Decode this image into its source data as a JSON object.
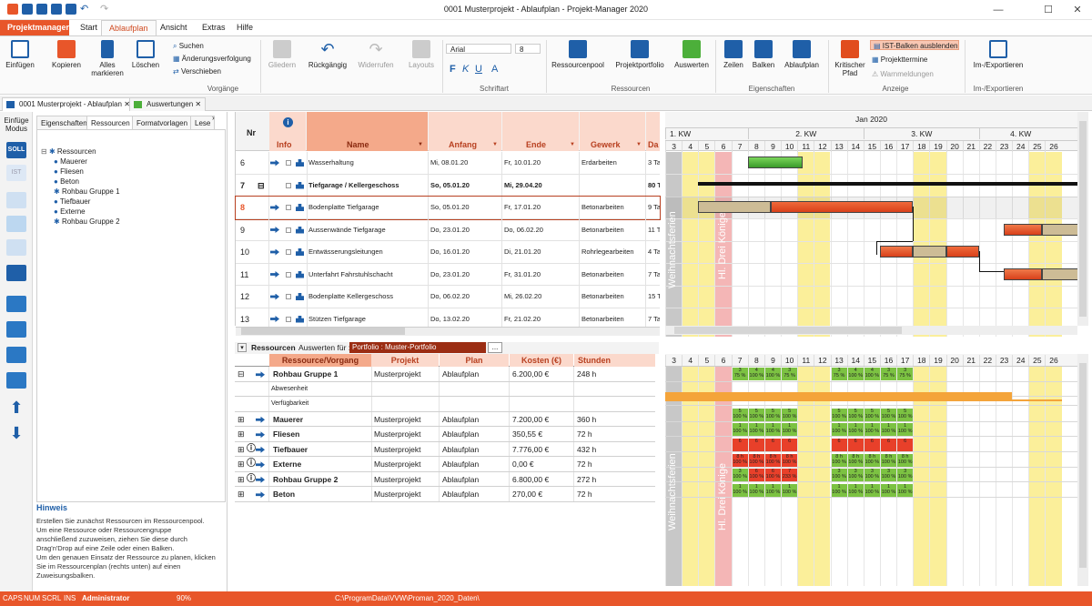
{
  "window": {
    "title": "0001 Musterprojekt - Ablaufplan - Projekt-Manager 2020"
  },
  "ribbon_tabs": [
    "Projektmanager",
    "Start",
    "Ablaufplan",
    "Ansicht",
    "Extras",
    "Hilfe"
  ],
  "ribbon": {
    "einfuegen": "Einfügen",
    "kopieren": "Kopieren",
    "alles_markieren": "Alles markieren",
    "loeschen": "Löschen",
    "suchen": "Suchen",
    "aenderungsverfolgung": "Änderungsverfolgung",
    "verschieben": "Verschieben",
    "gliedern": "Gliedern",
    "rueckgaengig": "Rückgängig",
    "wiederrufen": "Widerrufen",
    "layouts": "Layouts",
    "group_vorgaenge": "Vorgänge",
    "font_name": "Arial",
    "font_size": "8",
    "font_letters": [
      "F",
      "K",
      "U",
      "A"
    ],
    "group_schriftart": "Schriftart",
    "ressourcenpool": "Ressourcenpool",
    "projektportfolio": "Projektportfolio",
    "auswerten": "Auswerten",
    "group_ressourcen": "Ressourcen",
    "zeilen": "Zeilen",
    "balken": "Balken",
    "ablaufplan": "Ablaufplan",
    "group_eigenschaften": "Eigenschaften",
    "kritischer_pfad": "Kritischer Pfad",
    "ist_balken": "IST-Balken ausblenden",
    "projekttermine": "Projekttermine",
    "warnmeldungen": "Warnmeldungen",
    "group_anzeige": "Anzeige",
    "im_export": "Im-/Exportieren",
    "group_im_export": "Im-/Exportieren"
  },
  "doc_tabs": [
    "0001 Musterprojekt - Ablaufplan",
    "Auswertungen"
  ],
  "rail": {
    "label1": "Einfüge",
    "label2": "Modus",
    "soll": "SOLL",
    "ist": "IST"
  },
  "panel": {
    "tabs": [
      "Eigenschaften",
      "Ressourcen",
      "Formatvorlagen",
      "Lese"
    ],
    "tree_root": "Ressourcen",
    "tree_items": [
      "Mauerer",
      "Fliesen",
      "Beton",
      "Rohbau Gruppe 1",
      "Tiefbauer",
      "Externe",
      "Rohbau Gruppe 2"
    ],
    "hint_title": "Hinweis",
    "hint_lines": [
      "Erstellen Sie zunächst Ressourcen im Ressourcenpool.",
      "Um eine Ressource oder Ressourcengruppe",
      "anschließend zuzuweisen, ziehen Sie diese durch",
      "Drag'n'Drop auf eine Zeile oder einen Balken.",
      "Um den genauen Einsatz der Ressource zu planen, klicken",
      "Sie im Ressourcenplan (rechts unten) auf einen",
      "Zuweisungsbalken."
    ]
  },
  "task_table": {
    "headers": {
      "nr": "Nr",
      "info": "Info",
      "name": "Name",
      "anfang": "Anfang",
      "ende": "Ende",
      "gewerk": "Gewerk",
      "dauer": "Da"
    },
    "rows": [
      {
        "nr": "6",
        "name": "Wasserhaltung",
        "anfang": "Mi, 08.01.20",
        "ende": "Fr, 10.01.20",
        "gewerk": "Erdarbeiten",
        "dauer": "3 Ta",
        "bold": false
      },
      {
        "nr": "7",
        "name": "Tiefgarage / Kellergeschoss",
        "anfang": "So, 05.01.20",
        "ende": "Mi, 29.04.20",
        "gewerk": "",
        "dauer": "80 T",
        "bold": true
      },
      {
        "nr": "8",
        "name": "Bodenplatte Tiefgarage",
        "anfang": "So, 05.01.20",
        "ende": "Fr, 17.01.20",
        "gewerk": "Betonarbeiten",
        "dauer": "9 Ta",
        "bold": false
      },
      {
        "nr": "9",
        "name": "Aussenwände Tiefgarage",
        "anfang": "Do, 23.01.20",
        "ende": "Do, 06.02.20",
        "gewerk": "Betonarbeiten",
        "dauer": "11 T",
        "bold": false
      },
      {
        "nr": "10",
        "name": "Entwässerungsleitungen",
        "anfang": "Do, 16.01.20",
        "ende": "Di, 21.01.20",
        "gewerk": "Rohrlegearbeiten",
        "dauer": "4 Ta",
        "bold": false
      },
      {
        "nr": "11",
        "name": "Unterfahrt Fahrstuhlschacht",
        "anfang": "Do, 23.01.20",
        "ende": "Fr, 31.01.20",
        "gewerk": "Betonarbeiten",
        "dauer": "7 Ta",
        "bold": false
      },
      {
        "nr": "12",
        "name": "Bodenplatte Kellergeschoss",
        "anfang": "Do, 06.02.20",
        "ende": "Mi, 26.02.20",
        "gewerk": "Betonarbeiten",
        "dauer": "15 T",
        "bold": false
      },
      {
        "nr": "13",
        "name": "Stützen Tiefgarage",
        "anfang": "Do, 13.02.20",
        "ende": "Fr, 21.02.20",
        "gewerk": "Betonarbeiten",
        "dauer": "7 Ta",
        "bold": false
      }
    ]
  },
  "gantt": {
    "month": "Jan 2020",
    "weeks": [
      "1. KW",
      "2. KW",
      "3. KW",
      "4. KW"
    ],
    "days": [
      "3",
      "4",
      "5",
      "6",
      "7",
      "8",
      "9",
      "10",
      "11",
      "12",
      "13",
      "14",
      "15",
      "16",
      "17",
      "18",
      "19",
      "20",
      "21",
      "22",
      "23",
      "24",
      "25",
      "26"
    ],
    "holiday1": "Weihnachtsferien",
    "holiday2": "Hl. Drei Könige"
  },
  "res_bar": {
    "title": "Ressourcen",
    "auswerten_label": "Auswerten für :",
    "portfolio": "Portfolio : Muster-Portfolio",
    "btn": "..."
  },
  "res_table": {
    "headers": {
      "name": "Ressource/Vorgang",
      "projekt": "Projekt",
      "plan": "Plan",
      "kosten": "Kosten (€)",
      "stunden": "Stunden"
    },
    "rows": [
      {
        "name": "Rohbau Gruppe 1",
        "projekt": "Musterprojekt",
        "plan": "Ablaufplan",
        "kosten": "6.200,00 €",
        "stunden": "248 h",
        "warn": false,
        "expand": "⊟"
      },
      {
        "name": "Abwesenheit",
        "projekt": "",
        "plan": "",
        "kosten": "",
        "stunden": "",
        "warn": false,
        "expand": "",
        "sub": true
      },
      {
        "name": "Verfügbarkeit",
        "projekt": "",
        "plan": "",
        "kosten": "",
        "stunden": "",
        "warn": false,
        "expand": "",
        "sub": true
      },
      {
        "name": "Mauerer",
        "projekt": "Musterprojekt",
        "plan": "Ablaufplan",
        "kosten": "7.200,00 €",
        "stunden": "360 h",
        "warn": false,
        "expand": "⊞"
      },
      {
        "name": "Fliesen",
        "projekt": "Musterprojekt",
        "plan": "Ablaufplan",
        "kosten": "350,55 €",
        "stunden": "72 h",
        "warn": false,
        "expand": "⊞"
      },
      {
        "name": "Tiefbauer",
        "projekt": "Musterprojekt",
        "plan": "Ablaufplan",
        "kosten": "7.776,00 €",
        "stunden": "432 h",
        "warn": true,
        "expand": "⊞"
      },
      {
        "name": "Externe",
        "projekt": "Musterprojekt",
        "plan": "Ablaufplan",
        "kosten": "0,00 €",
        "stunden": "72 h",
        "warn": true,
        "expand": "⊞"
      },
      {
        "name": "Rohbau Gruppe 2",
        "projekt": "Musterprojekt",
        "plan": "Ablaufplan",
        "kosten": "6.800,00 €",
        "stunden": "272 h",
        "warn": true,
        "expand": "⊞"
      },
      {
        "name": "Beton",
        "projekt": "Musterprojekt",
        "plan": "Ablaufplan",
        "kosten": "270,00 €",
        "stunden": "72 h",
        "warn": false,
        "expand": "⊞"
      }
    ]
  },
  "status": {
    "caps": "CAPS",
    "num": "NUM",
    "scrl": "SCRL",
    "ins": "INS",
    "user": "Administrator",
    "zoom": "90%",
    "path": "C:\\ProgramData\\VVW\\Proman_2020_Daten\\"
  },
  "colors": {
    "accent": "#e8562a",
    "header_bg": "#fbd9cc",
    "weekend": "#fbef9a",
    "holiday": "#f4b6b6",
    "bar_green": "#4caf3a",
    "bar_red": "#e14d1e"
  }
}
